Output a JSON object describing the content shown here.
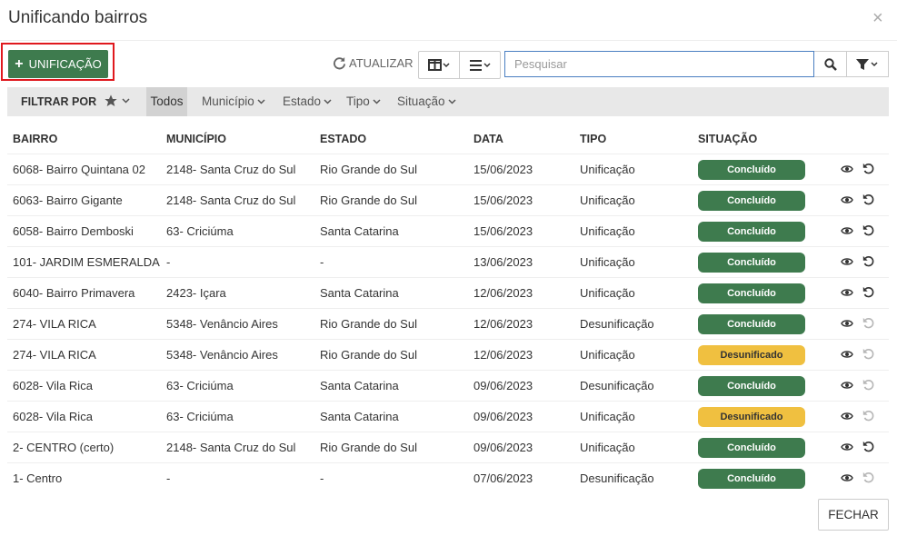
{
  "dialog": {
    "title": "Unificando bairros",
    "close": "×"
  },
  "toolbar": {
    "add_label": "UNIFICAÇÃO",
    "refresh_label": "ATUALIZAR",
    "search_placeholder": "Pesquisar"
  },
  "filter": {
    "label": "FILTRAR POR",
    "todos": "Todos",
    "options": [
      "Município",
      "Estado",
      "Tipo",
      "Situação"
    ]
  },
  "table": {
    "headers": [
      "BAIRRO",
      "MUNICÍPIO",
      "ESTADO",
      "DATA",
      "TIPO",
      "SITUAÇÃO"
    ],
    "rows": [
      {
        "bairro": "6068- Bairro Quintana 02",
        "municipio": "2148- Santa Cruz do Sul",
        "estado": "Rio Grande do Sul",
        "data": "15/06/2023",
        "tipo": "Unificação",
        "situacao": "Concluído",
        "status": "ok",
        "undo": true
      },
      {
        "bairro": "6063- Bairro Gigante",
        "municipio": "2148- Santa Cruz do Sul",
        "estado": "Rio Grande do Sul",
        "data": "15/06/2023",
        "tipo": "Unificação",
        "situacao": "Concluído",
        "status": "ok",
        "undo": true
      },
      {
        "bairro": "6058- Bairro Demboski",
        "municipio": "63- Criciúma",
        "estado": "Santa Catarina",
        "data": "15/06/2023",
        "tipo": "Unificação",
        "situacao": "Concluído",
        "status": "ok",
        "undo": true
      },
      {
        "bairro": "101- JARDIM ESMERALDA",
        "municipio": "-",
        "estado": "-",
        "data": "13/06/2023",
        "tipo": "Unificação",
        "situacao": "Concluído",
        "status": "ok",
        "undo": true
      },
      {
        "bairro": "6040- Bairro Primavera",
        "municipio": "2423- Içara",
        "estado": "Santa Catarina",
        "data": "12/06/2023",
        "tipo": "Unificação",
        "situacao": "Concluído",
        "status": "ok",
        "undo": true
      },
      {
        "bairro": "274- VILA RICA",
        "municipio": "5348- Venâncio Aires",
        "estado": "Rio Grande do Sul",
        "data": "12/06/2023",
        "tipo": "Desunificação",
        "situacao": "Concluído",
        "status": "ok",
        "undo": false
      },
      {
        "bairro": "274- VILA RICA",
        "municipio": "5348- Venâncio Aires",
        "estado": "Rio Grande do Sul",
        "data": "12/06/2023",
        "tipo": "Unificação",
        "situacao": "Desunificado",
        "status": "warn",
        "undo": false
      },
      {
        "bairro": "6028- Vila Rica",
        "municipio": "63- Criciúma",
        "estado": "Santa Catarina",
        "data": "09/06/2023",
        "tipo": "Desunificação",
        "situacao": "Concluído",
        "status": "ok",
        "undo": false
      },
      {
        "bairro": "6028- Vila Rica",
        "municipio": "63- Criciúma",
        "estado": "Santa Catarina",
        "data": "09/06/2023",
        "tipo": "Unificação",
        "situacao": "Desunificado",
        "status": "warn",
        "undo": false
      },
      {
        "bairro": "2- CENTRO (certo)",
        "municipio": "2148- Santa Cruz do Sul",
        "estado": "Rio Grande do Sul",
        "data": "09/06/2023",
        "tipo": "Unificação",
        "situacao": "Concluído",
        "status": "ok",
        "undo": true
      },
      {
        "bairro": "1- Centro",
        "municipio": "-",
        "estado": "-",
        "data": "07/06/2023",
        "tipo": "Desunificação",
        "situacao": "Concluído",
        "status": "ok",
        "undo": false
      }
    ]
  },
  "footer": {
    "close_label": "FECHAR"
  },
  "colors": {
    "primary_green": "#3e7b4e",
    "warning_yellow": "#f0c040",
    "highlight_red": "#e0191e"
  }
}
